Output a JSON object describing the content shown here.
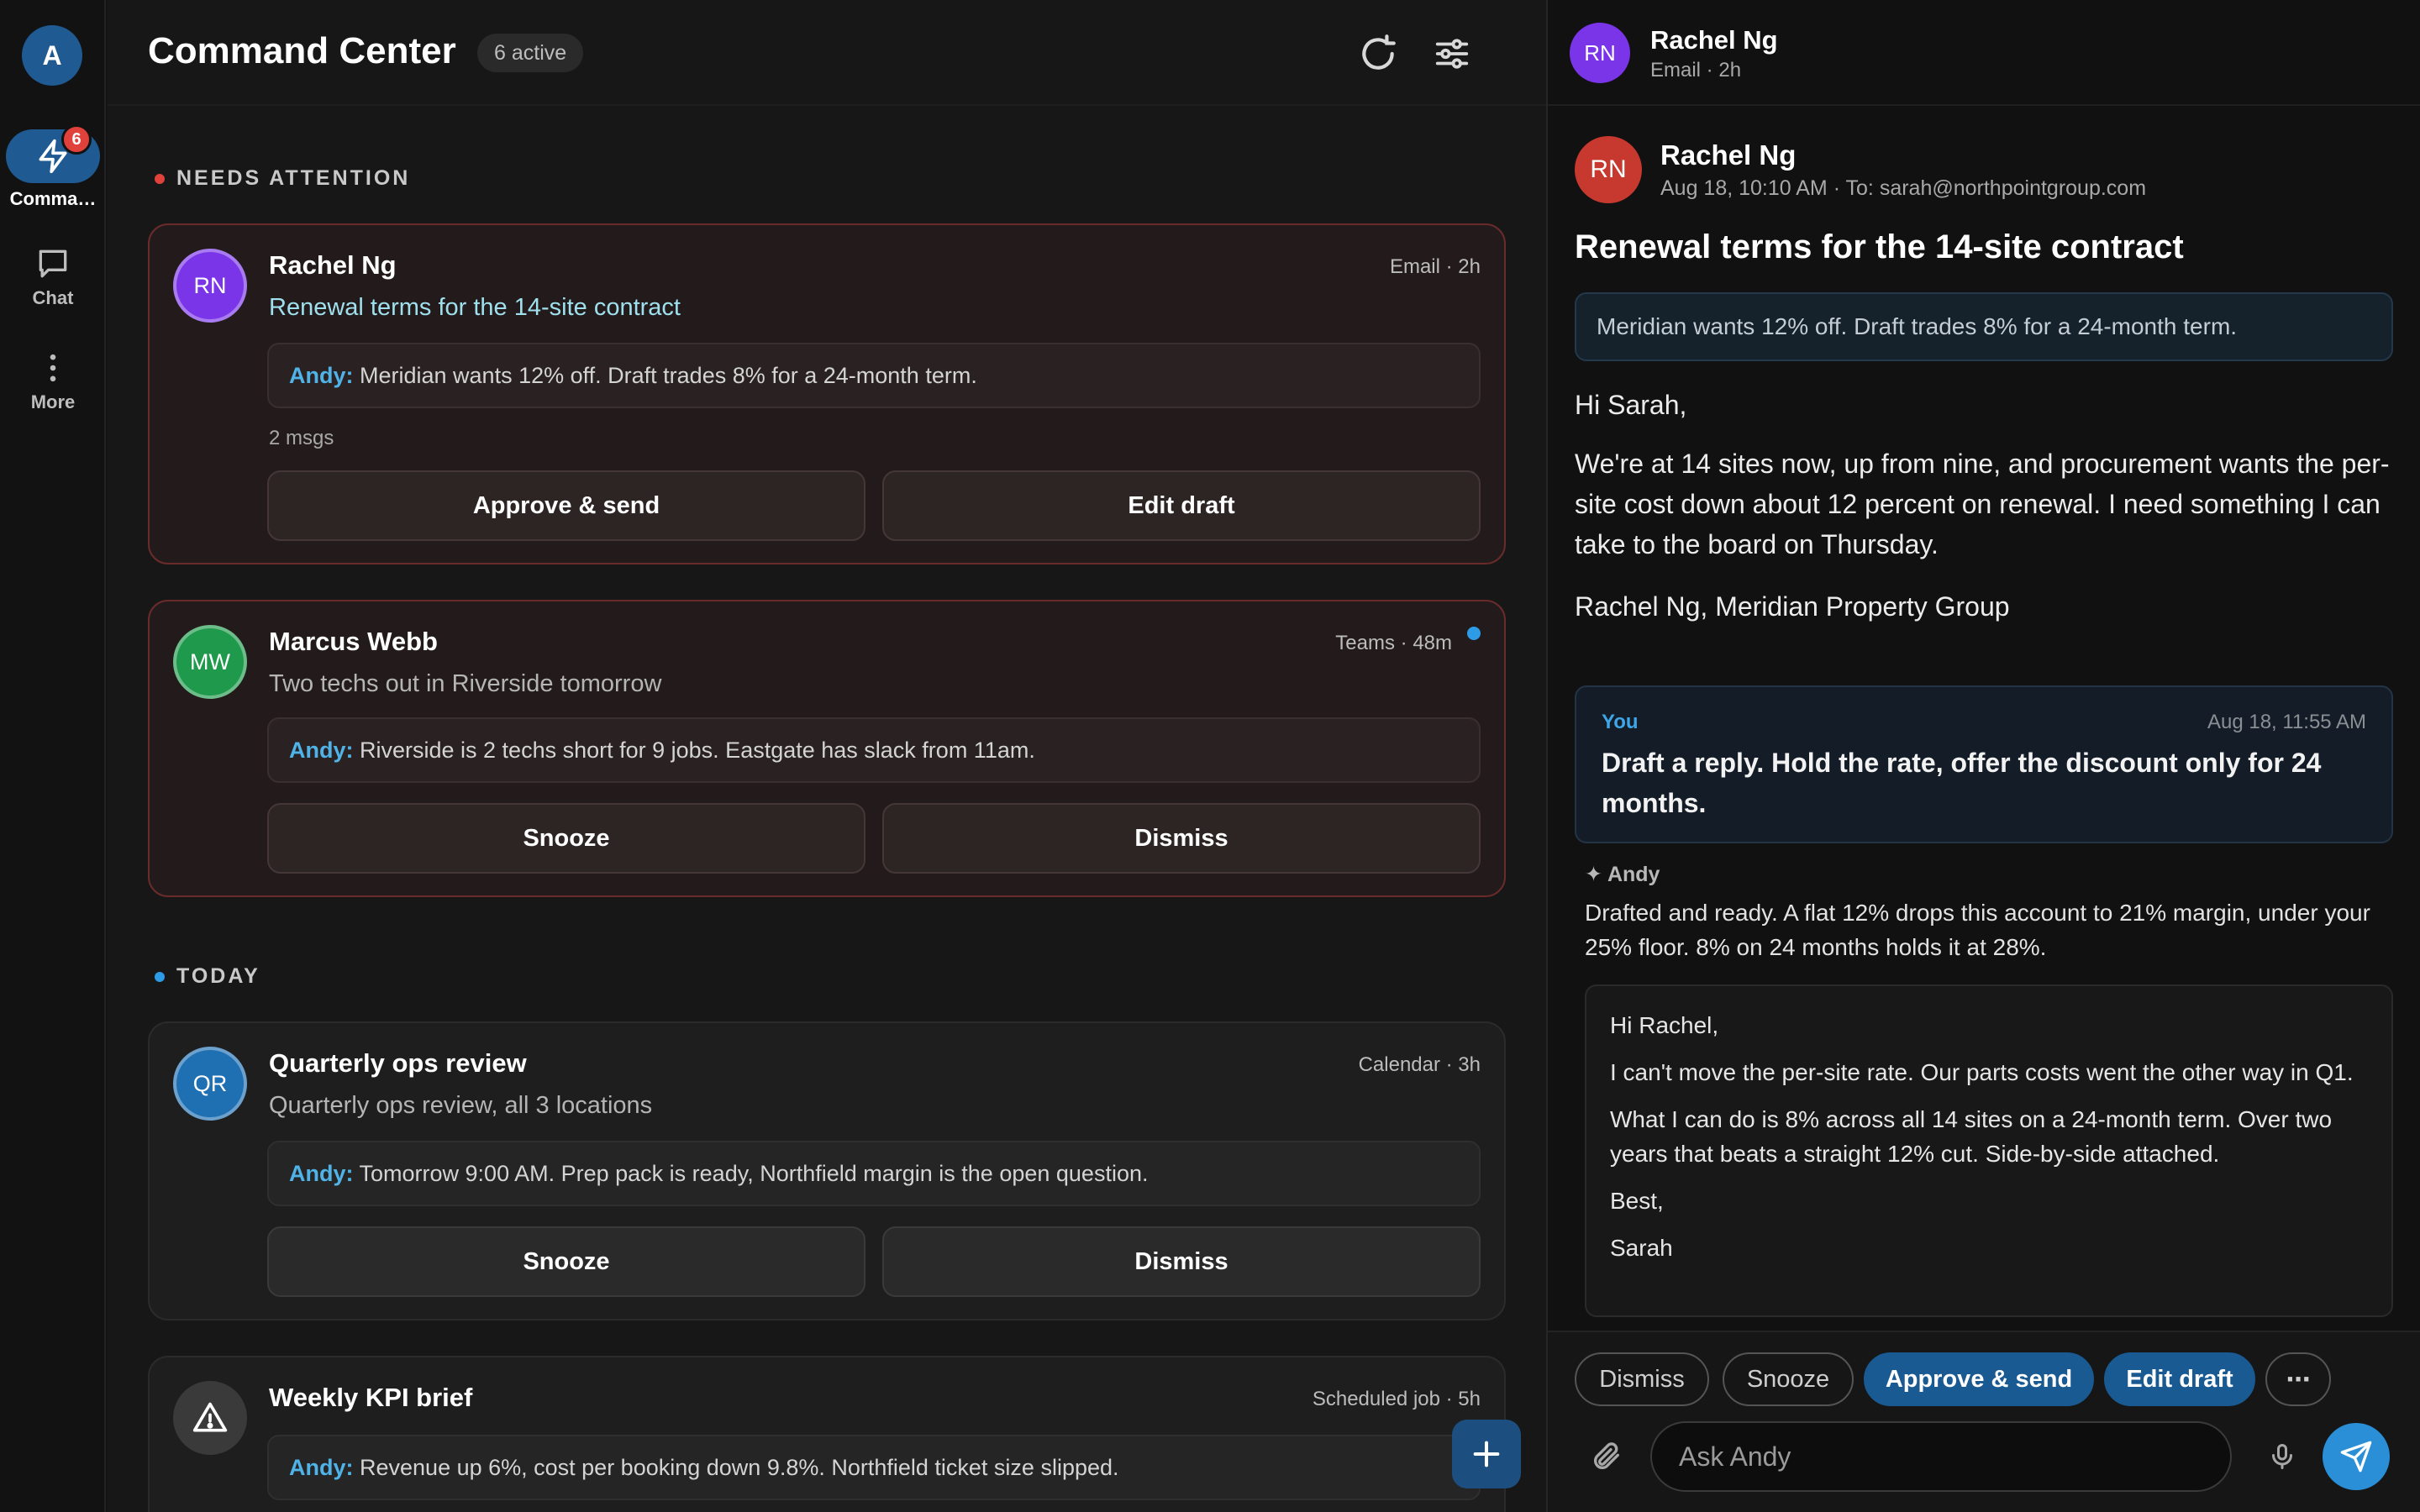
{
  "rail": {
    "avatar_initial": "A",
    "command": {
      "label": "Comma…",
      "badge": "6",
      "icon": "lightning-icon"
    },
    "chat": {
      "label": "Chat",
      "icon": "chat-bubble-icon"
    },
    "more": {
      "label": "More",
      "icon": "vertical-dots-icon"
    }
  },
  "header": {
    "title": "Command Center",
    "active_count": "6 active",
    "icons": [
      "refresh-icon",
      "sliders-icon"
    ]
  },
  "sections": {
    "needs_attention": "NEEDS ATTENTION",
    "today": "TODAY"
  },
  "cards": [
    {
      "initials": "RN",
      "avatar_color": "#7b35e8",
      "name": "Rachel Ng",
      "meta": "Email · 2h",
      "subject": "Renewal terms for the 14-site contract",
      "andy_label": "Andy:",
      "andy_text": " Meridian wants 12% off. Draft trades 8% for a 24-month term.",
      "count": "2 msgs",
      "buttons": [
        "Approve & send",
        "Edit draft"
      ]
    },
    {
      "initials": "MW",
      "avatar_color": "#1f9a4c",
      "name": "Marcus Webb",
      "meta": "Teams · 48m",
      "subject": "Two techs out in Riverside tomorrow",
      "andy_label": "Andy:",
      "andy_text": " Riverside is 2 techs short for 9 jobs. Eastgate has slack from 11am.",
      "buttons": [
        "Snooze",
        "Dismiss"
      ]
    },
    {
      "initials": "QR",
      "avatar_color": "#1f6fb3",
      "name": "Quarterly ops review",
      "meta": "Calendar · 3h",
      "subject": "Quarterly ops review, all 3 locations",
      "andy_label": "Andy:",
      "andy_text": " Tomorrow 9:00 AM. Prep pack is ready, Northfield margin is the open question.",
      "buttons": [
        "Snooze",
        "Dismiss"
      ]
    },
    {
      "icon": "warning-triangle-icon",
      "name": "Weekly KPI brief",
      "meta": "Scheduled job · 5h",
      "andy_label": "Andy:",
      "andy_text": " Revenue up 6%, cost per booking down 9.8%. Northfield ticket size slipped."
    }
  ],
  "panel": {
    "header": {
      "initials": "RN",
      "name": "Rachel Ng",
      "sub": "Email · 2h"
    },
    "message": {
      "initials": "RN",
      "from": "Rachel Ng",
      "sub": "Aug 18, 10:10 AM · To: sarah@northpointgroup.com",
      "subject": "Renewal terms for the 14-site contract",
      "summary": "Meridian wants 12% off. Draft trades 8% for a 24-month term.",
      "greeting": "Hi Sarah,",
      "body": "We're at 14 sites now, up from nine, and procurement wants the per-site cost down about 12 percent on renewal. I need something I can take to the board on Thursday.",
      "signature": "Rachel Ng, Meridian Property Group"
    },
    "you": {
      "label": "You",
      "time": "Aug 18, 11:55 AM",
      "text": "Draft a reply. Hold the rate, offer the discount only for 24 months."
    },
    "andy": {
      "label": "✦ Andy",
      "text": "Drafted and ready. A flat 12% drops this account to 21% margin, under your 25% floor. 8% on 24 months holds it at 28%."
    },
    "draft": {
      "greeting": "Hi Rachel,",
      "p1": "I can't move the per-site rate. Our parts costs went the other way in Q1.",
      "p2": "What I can do is 8% across all 14 sites on a 24-month term. Over two years that beats a straight 12% cut. Side-by-side attached.",
      "closing": "Best,",
      "name": "Sarah"
    },
    "actions": {
      "dismiss": "Dismiss",
      "snooze": "Snooze",
      "approve": "Approve & send",
      "edit": "Edit draft",
      "more": "⋯"
    },
    "input": {
      "placeholder": "Ask Andy"
    }
  },
  "colors": {
    "accent": "#1f5a93",
    "andy_label": "#4fb3e8",
    "alert_border": "#6a2b2b",
    "badge": "#e0413b"
  }
}
